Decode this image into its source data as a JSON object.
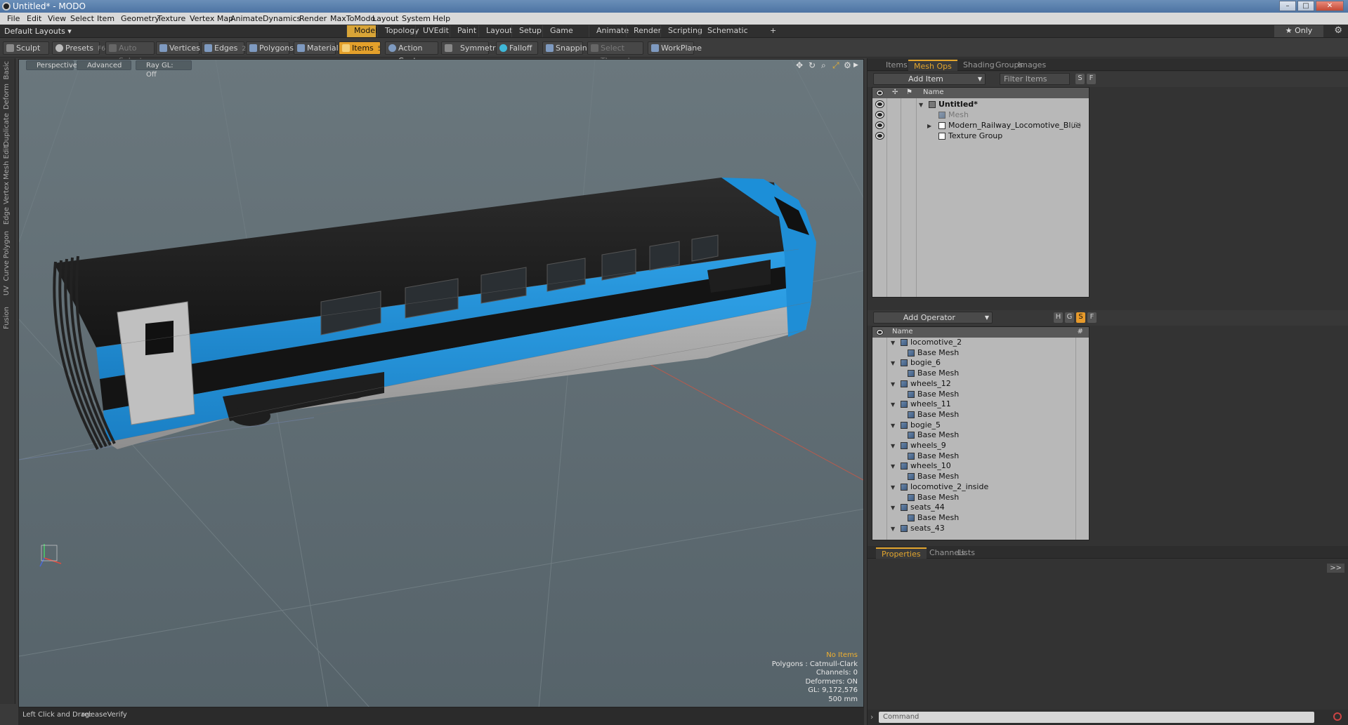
{
  "window": {
    "title": "Untitled* - MODO"
  },
  "menu": [
    "File",
    "Edit",
    "View",
    "Select",
    "Item",
    "Geometry",
    "Texture",
    "Vertex Map",
    "Animate",
    "Dynamics",
    "Render",
    "MaxToModo",
    "Layout",
    "System",
    "Help"
  ],
  "layouts": {
    "label": "Default Layouts ▾"
  },
  "tabs": [
    "Model",
    "Topology",
    "UVEdit",
    "Paint",
    "Layout",
    "Setup",
    "Game Tools",
    "Animate",
    "Render",
    "Scripting",
    "Schematic Fusion"
  ],
  "tab_add": "+",
  "only_label": "★ Only",
  "toolbar": {
    "sculpt": "Sculpt",
    "presets": "Presets",
    "presets_key": "F6",
    "auto_select": "Auto Select",
    "vertices": "Vertices",
    "vertices_key": "1",
    "edges": "Edges",
    "edges_key": "2",
    "polygons": "Polygons",
    "materials": "Materials",
    "items": "Items",
    "items_key": "5",
    "action_center": "Action Center",
    "symmetry": "Symmetry",
    "falloff": "Falloff",
    "snapping": "Snapping",
    "select_through": "Select Through",
    "workplane": "WorkPlane"
  },
  "left_tabs": [
    "Basic",
    "Deform",
    "Duplicate",
    "Mesh Edit",
    "Vertex",
    "Edge",
    "Polygon",
    "Curve",
    "UV",
    "Fusion"
  ],
  "viewport": {
    "view": "Perspective",
    "shading": "Advanced",
    "raygl": "Ray GL: Off",
    "info": {
      "selection": "No Items",
      "polygons": "Polygons : Catmull-Clark",
      "channels": "Channels: 0",
      "deformers": "Deformers: ON",
      "gl": "GL: 9,172,576",
      "scale": "500 mm"
    }
  },
  "status": {
    "hint_label": "Left Click and Drag:",
    "hint_value": "releaseVerify"
  },
  "items_panel": {
    "tabs": [
      "Items",
      "Mesh Ops",
      "Shading",
      "Groups",
      "Images"
    ],
    "active_tab": "Mesh Ops",
    "add_item": "Add Item",
    "filter": "Filter Items",
    "col_name": "Name",
    "rows": [
      {
        "label": "Untitled*"
      },
      {
        "label": "Mesh"
      },
      {
        "label": "Modern_Railway_Locomotive_Blue",
        "count": "(3)"
      },
      {
        "label": "Texture Group"
      }
    ]
  },
  "operators_panel": {
    "add_operator": "Add Operator",
    "col_name": "Name",
    "col_num": "#",
    "rows": [
      {
        "label": "locomotive_2",
        "level": 0
      },
      {
        "label": "Base Mesh",
        "level": 1
      },
      {
        "label": "bogie_6",
        "level": 0
      },
      {
        "label": "Base Mesh",
        "level": 1
      },
      {
        "label": "wheels_12",
        "level": 0
      },
      {
        "label": "Base Mesh",
        "level": 1
      },
      {
        "label": "wheels_11",
        "level": 0
      },
      {
        "label": "Base Mesh",
        "level": 1
      },
      {
        "label": "bogie_5",
        "level": 0
      },
      {
        "label": "Base Mesh",
        "level": 1
      },
      {
        "label": "wheels_9",
        "level": 0
      },
      {
        "label": "Base Mesh",
        "level": 1
      },
      {
        "label": "wheels_10",
        "level": 0
      },
      {
        "label": "Base Mesh",
        "level": 1
      },
      {
        "label": "locomotive_2_inside",
        "level": 0
      },
      {
        "label": "Base Mesh",
        "level": 1
      },
      {
        "label": "seats_44",
        "level": 0
      },
      {
        "label": "Base Mesh",
        "level": 1
      },
      {
        "label": "seats_43",
        "level": 0
      }
    ]
  },
  "properties_panel": {
    "tabs": [
      "Properties",
      "Channels",
      "Lists"
    ],
    "active_tab": "Properties"
  },
  "command": {
    "placeholder": "Command"
  },
  "colors": {
    "accent": "#e2a52e",
    "train_blue": "#1e90d8",
    "viewport_bg": "#5e6a70"
  }
}
